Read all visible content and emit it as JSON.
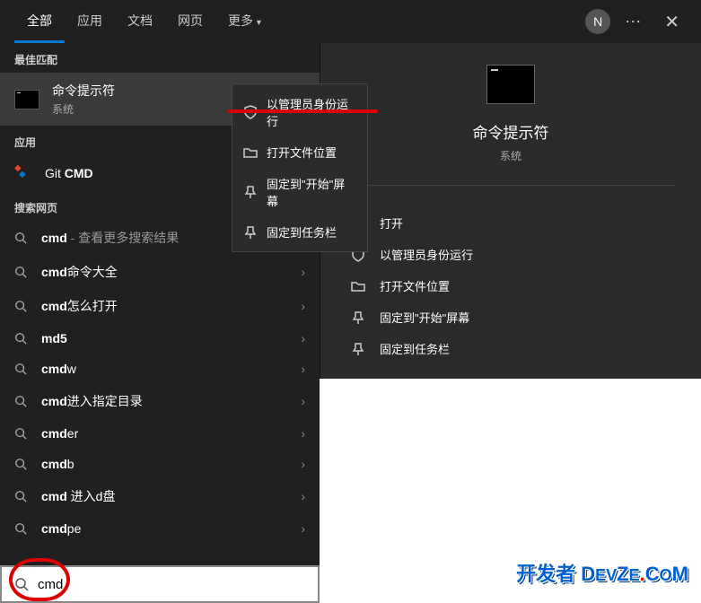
{
  "tabs": {
    "all": "全部",
    "apps": "应用",
    "docs": "文档",
    "web": "网页",
    "more": "更多"
  },
  "user_initial": "N",
  "sections": {
    "best_match": "最佳匹配",
    "apps": "应用",
    "search_web": "搜索网页"
  },
  "best_match": {
    "title": "命令提示符",
    "subtitle": "系统"
  },
  "app_items": [
    {
      "prefix": "Git ",
      "bold": "CMD"
    }
  ],
  "web_items": [
    {
      "bold": "cmd",
      "rest": " - 查看更多搜索结果",
      "chev": true
    },
    {
      "bold": "cmd",
      "rest": "命令大全",
      "chev": true
    },
    {
      "bold": "cmd",
      "rest": "怎么打开",
      "chev": true
    },
    {
      "bold": "md5",
      "rest": "",
      "chev": true
    },
    {
      "bold": "cmd",
      "rest": "w",
      "chev": true
    },
    {
      "bold": "cmd",
      "rest": "进入指定目录",
      "chev": true
    },
    {
      "bold": "cmd",
      "rest": "er",
      "chev": true
    },
    {
      "bold": "cmd",
      "rest": "b",
      "chev": true
    },
    {
      "bold": "cmd",
      "rest": " 进入d盘",
      "chev": true
    },
    {
      "bold": "cmd",
      "rest": "pe",
      "chev": true
    }
  ],
  "context_menu": [
    "以管理员身份运行",
    "打开文件位置",
    "固定到\"开始\"屏幕",
    "固定到任务栏"
  ],
  "preview": {
    "title": "命令提示符",
    "subtitle": "系统",
    "actions": [
      "打开",
      "以管理员身份运行",
      "打开文件位置",
      "固定到\"开始\"屏幕",
      "固定到任务栏"
    ]
  },
  "search_value": "cmd",
  "watermark": "开发者 DevZe.CoM"
}
